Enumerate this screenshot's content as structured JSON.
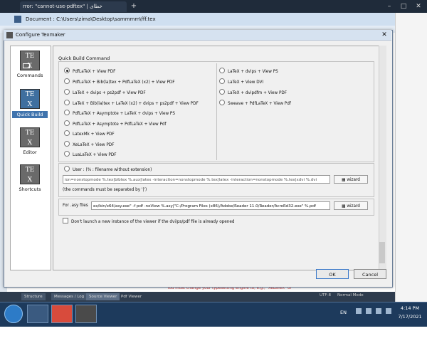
{
  "browser": {
    "tab_title": "rror: \"cannot-use-pdftex\" | خطای",
    "new_tab": "+",
    "min": "–",
    "max": "□",
    "close": "✕"
  },
  "texmaker": {
    "title": "Document : C:\\Users\\zima\\Desktop\\sammmm\\fff.tex",
    "bottom_tabs": [
      "Structure",
      "Messages / Log",
      "Source Viewer",
      "Pdf Viewer"
    ],
    "message": "You must change your typesetting engine to, e.g., \"XeLaTeX\" or",
    "encoding": "UTF-8",
    "mode": "Normal Mode"
  },
  "dialog": {
    "title": "Configure Texmaker",
    "close": "✕",
    "sidebar": [
      {
        "label": "Commands",
        "selected": false
      },
      {
        "label": "Quick Build",
        "selected": true
      },
      {
        "label": "Editor",
        "selected": false
      },
      {
        "label": "Shortcuts",
        "selected": false
      }
    ],
    "quick_build_label": "Quick Build Command",
    "options_left": [
      {
        "label": "PdfLaTeX + View PDF",
        "selected": true
      },
      {
        "label": "PdfLaTeX + Bib(la)tex + PdfLaTeX (x2) + View PDF",
        "selected": false
      },
      {
        "label": "LaTeX + dvips + ps2pdf + View PDF",
        "selected": false
      },
      {
        "label": "LaTeX + Bib(la)tex + LaTeX (x2) + dvips + ps2pdf + View PDF",
        "selected": false
      },
      {
        "label": "PdfLaTeX + Asymptote + LaTeX + dvips + View PS",
        "selected": false
      },
      {
        "label": "PdfLaTeX + Asymptote + PdfLaTeX + View Pdf",
        "selected": false
      },
      {
        "label": "LatexMk + View PDF",
        "selected": false
      },
      {
        "label": "XeLaTeX + View PDF",
        "selected": false
      },
      {
        "label": "LuaLaTeX + View PDF",
        "selected": false
      }
    ],
    "options_right": [
      {
        "label": "LaTeX + dvips + View PS",
        "selected": false
      },
      {
        "label": "LaTeX + View DVI",
        "selected": false
      },
      {
        "label": "LaTeX + dvipdfm + View PDF",
        "selected": false
      },
      {
        "label": "Sweave + PdfLaTeX + View Pdf",
        "selected": false
      }
    ],
    "user_label": "User : (% : filename without extension)",
    "user_command": "ion=nonstopmode %.tex|bibtex %.aux|latex -interaction=nonstopmode %.tex|latex -interaction=nonstopmode %.tex|xdvi %.dvi",
    "wizard": "wizard",
    "user_note": "(the commands must be separated by '|')",
    "asy_label": "For .asy files",
    "asy_command": "ex/bin/x64/asy.exe\" -f pdf -noView %.asy|\"C:/Program Files (x86)/Adobe/Reader 11.0/Reader/AcroRd32.exe\" %.pdf",
    "viewer_label": "Don't launch a new instance of the viewer if the dvi/ps/pdf file is already opened",
    "ok": "OK",
    "cancel": "Cancel"
  },
  "taskbar": {
    "lang": "EN",
    "time": "4:14 PM",
    "date": "7/17/2021"
  }
}
